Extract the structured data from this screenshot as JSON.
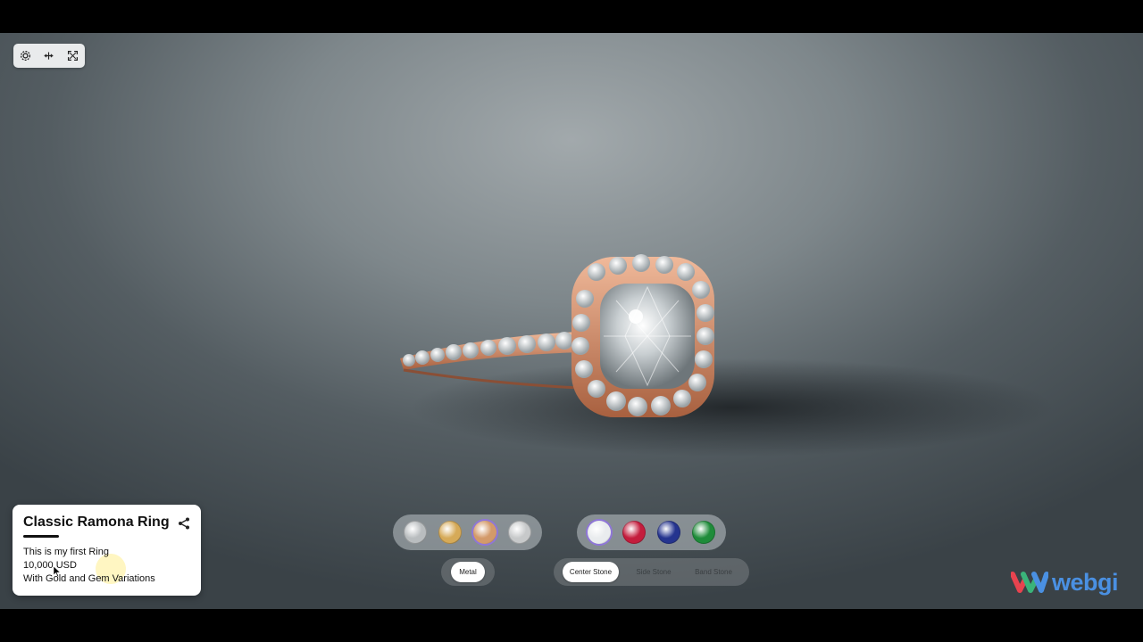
{
  "viewer": {
    "toolbar": {
      "icons": [
        "settings-gear-icon",
        "rotate-icon",
        "fullscreen-icon"
      ]
    }
  },
  "product": {
    "title": "Classic Ramona Ring",
    "description": "This is my first Ring",
    "price": "10,000 USD",
    "note": "With Gold and Gem Variations"
  },
  "metal_picker": {
    "swatches": [
      {
        "name": "silver-metal",
        "color": "#b9bdbf",
        "selected": false
      },
      {
        "name": "yellow-gold-metal",
        "color": "#d6aa58",
        "selected": false
      },
      {
        "name": "rose-gold-metal",
        "color": "#d39a6a",
        "selected": true
      },
      {
        "name": "platinum-metal",
        "color": "#c7c9ca",
        "selected": false
      }
    ],
    "tab_label": "Metal"
  },
  "stone_picker": {
    "swatches": [
      {
        "name": "diamond-stone",
        "color": "#e9ecee",
        "selected": true
      },
      {
        "name": "ruby-stone",
        "color": "#c41d3d",
        "selected": false
      },
      {
        "name": "sapphire-stone",
        "color": "#25348f",
        "selected": false
      },
      {
        "name": "emerald-stone",
        "color": "#1f8c3a",
        "selected": false
      }
    ],
    "tabs": [
      {
        "label": "Center Stone",
        "active": true
      },
      {
        "label": "Side Stone",
        "active": false
      },
      {
        "label": "Band Stone",
        "active": false
      }
    ]
  },
  "brand": {
    "name": "webgi",
    "colors": {
      "primary": "#4a90e2",
      "logo_red": "#e8434f",
      "logo_green": "#3ab37a"
    }
  }
}
